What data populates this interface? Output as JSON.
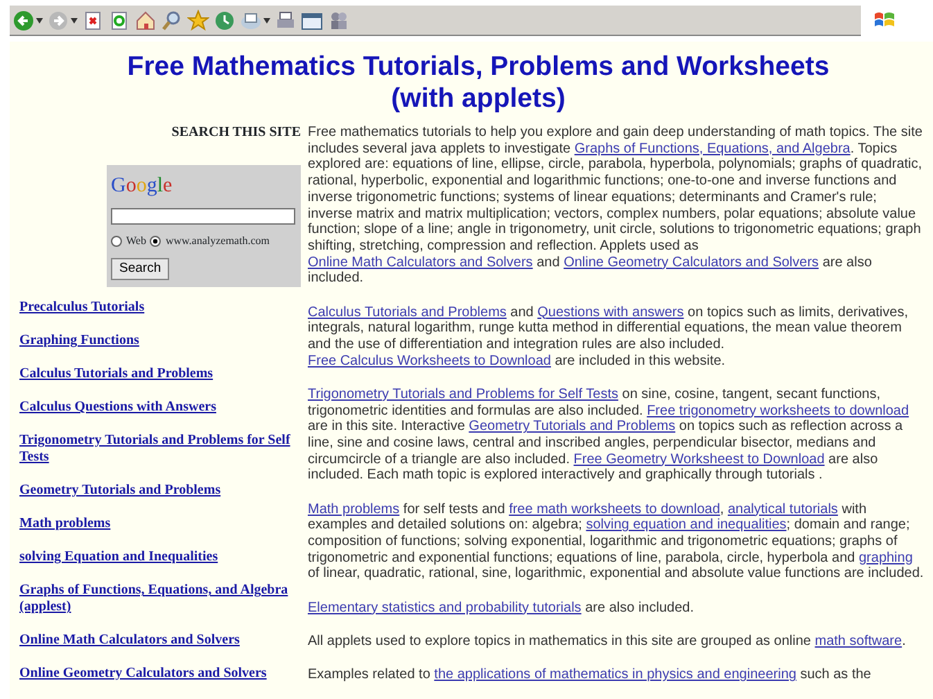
{
  "toolbar": {
    "buttons": [
      {
        "kind": "back",
        "dropdown": true
      },
      {
        "kind": "forward",
        "dropdown": true
      },
      {
        "kind": "stop",
        "dropdown": false
      },
      {
        "kind": "refresh",
        "dropdown": false
      },
      {
        "kind": "home",
        "dropdown": false
      },
      {
        "kind": "search",
        "dropdown": false
      },
      {
        "kind": "star",
        "dropdown": false
      },
      {
        "kind": "history",
        "dropdown": false
      },
      {
        "kind": "mail",
        "dropdown": true
      },
      {
        "kind": "print",
        "dropdown": false
      },
      {
        "kind": "edit",
        "dropdown": false
      },
      {
        "kind": "people",
        "dropdown": false
      }
    ]
  },
  "title": {
    "line1": "Free Mathematics Tutorials, Problems and Worksheets",
    "line2": "(with applets)"
  },
  "search": {
    "label": "SEARCH THIS SITE",
    "logo": "Google",
    "options": [
      {
        "label": "Web",
        "selected": false
      },
      {
        "label": "www.analyzemath.com",
        "selected": true
      }
    ],
    "button": "Search"
  },
  "sidebar": {
    "items": [
      {
        "label": "Precalculus Tutorials"
      },
      {
        "label": "Graphing Functions"
      },
      {
        "label": "Calculus Tutorials and Problems"
      },
      {
        "label": "Calculus Questions with Answers"
      },
      {
        "label": "Trigonometry Tutorials and Problems for Self Tests"
      },
      {
        "label": "Geometry Tutorials and Problems"
      },
      {
        "label": "Math problems"
      },
      {
        "label": "solving Equation and Inequalities"
      },
      {
        "label": "Graphs of Functions, Equations, and Algebra (applest)"
      },
      {
        "label": "Online Math Calculators and Solvers"
      },
      {
        "label": "Online Geometry Calculators and Solvers"
      }
    ]
  },
  "paragraphs": [
    [
      {
        "text": "Free mathematics tutorials to help you explore and gain deep understanding of math topics. The site includes several java applets to investigate "
      },
      {
        "link": "Graphs of Functions, Equations, and Algebra"
      },
      {
        "text": ". Topics explored are: equations of line, ellipse, circle, parabola, hyperbola, polynomials; graphs of quadratic, rational, hyperbolic, exponential and logarithmic functions; one-to-one and inverse functions and inverse trigonometric functions; systems of linear equations; determinants and Cramer's rule; inverse matrix and matrix multiplication; vectors, complex numbers, polar equations; absolute value function; slope of a line; angle in trigonometry, unit circle, solutions to trigonometric equations; graph shifting, stretching, compression and reflection. Applets used as "
      },
      {
        "link": "Online Math Calculators and Solvers"
      },
      {
        "text": " and "
      },
      {
        "link": "Online Geometry Calculators and Solvers"
      },
      {
        "text": " are also included."
      }
    ],
    [
      {
        "link": "Calculus Tutorials and Problems"
      },
      {
        "text": " and "
      },
      {
        "link": "Questions with answers"
      },
      {
        "text": " on topics such as limits, derivatives, integrals, natural logarithm, runge kutta method in differential equations, the mean value theorem and the use of differentiation and integration rules are also included. "
      },
      {
        "link": "Free Calculus Worksheets to Download"
      },
      {
        "text": " are included in this website."
      }
    ],
    [
      {
        "link": "Trigonometry Tutorials and Problems for Self Tests"
      },
      {
        "text": " on sine, cosine, tangent, secant functions, trigonometric identities and formulas are also included. "
      },
      {
        "link": "Free trigonometry worksheets to download"
      },
      {
        "text": " are in this site. Interactive "
      },
      {
        "link": "Geometry Tutorials and Problems"
      },
      {
        "text": " on topics such as reflection across a line, sine and cosine laws, central and inscribed angles, perpendicular bisector, medians and circumcircle of a triangle are also included. "
      },
      {
        "link": "Free Geometry Worksheest to Download"
      },
      {
        "text": " are also included. Each math topic is explored interactively and graphically through tutorials ."
      }
    ],
    [
      {
        "link": "Math problems"
      },
      {
        "text": " for self tests and "
      },
      {
        "link": "free math worksheets to download"
      },
      {
        "text": ", "
      },
      {
        "link": "analytical tutorials"
      },
      {
        "text": " with examples and detailed solutions on: algebra; "
      },
      {
        "link": "solving equation and inequalities"
      },
      {
        "text": "; domain and range; composition of functions; solving exponential, logarithmic and trigonometric equations; graphs of trigonometric and exponential functions; equations of line, parabola, circle, hyperbola and "
      },
      {
        "link": "graphing"
      },
      {
        "text": " of linear, quadratic, rational, sine, logarithmic, exponential and absolute value functions are included."
      }
    ],
    [
      {
        "link": "Elementary statistics and probability tutorials"
      },
      {
        "text": " are also included."
      }
    ],
    [
      {
        "text": "All applets used to explore topics in mathematics in this site are grouped as online "
      },
      {
        "link": "math software"
      },
      {
        "text": "."
      }
    ],
    [
      {
        "text": "Examples related to "
      },
      {
        "link": "the applications of mathematics in physics and engineering"
      },
      {
        "text": " such as the"
      }
    ]
  ]
}
